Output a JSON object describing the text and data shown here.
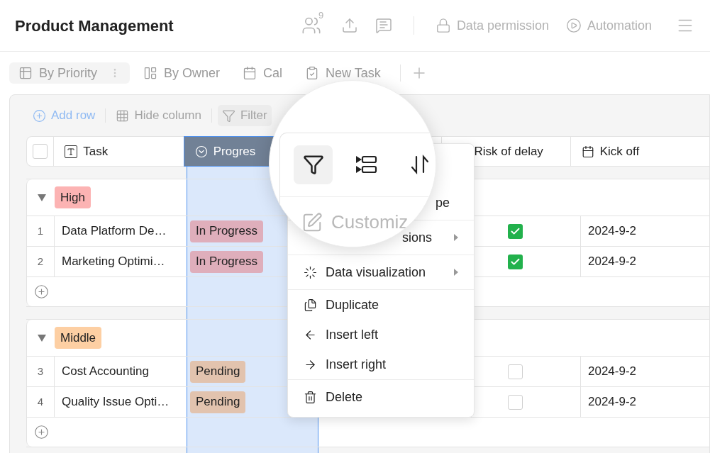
{
  "header": {
    "title": "Product Management",
    "collaborators_count": "9",
    "actions": [
      {
        "kind": "lock",
        "label": "Data permission"
      },
      {
        "kind": "automation",
        "label": "Automation"
      }
    ]
  },
  "views": [
    {
      "kind": "grid",
      "label": "By Priority",
      "selected": true
    },
    {
      "kind": "kanban",
      "label": "By Owner",
      "selected": false
    },
    {
      "kind": "calendar",
      "label": "Cal",
      "selected": false
    },
    {
      "kind": "form",
      "label": "New Task",
      "selected": false
    }
  ],
  "toolbar": [
    {
      "kind": "add",
      "label": "Add row"
    },
    {
      "kind": "hide",
      "label": "Hide column"
    },
    {
      "kind": "filter",
      "label": "Filter"
    }
  ],
  "header_checkbox": {
    "checked": false
  },
  "columns": [
    {
      "kind": "text",
      "label": "Task",
      "selected": false
    },
    {
      "kind": "select",
      "label": "Progres",
      "selected": true
    },
    {
      "kind": "check",
      "label": "Risk of delay",
      "selected": false
    },
    {
      "kind": "date",
      "label": "Kick off",
      "selected": false
    }
  ],
  "groups": [
    {
      "label": "High",
      "color": "#fcb3b3",
      "expanded": true,
      "rows": [
        {
          "index": "1",
          "task": "Data Platform De…",
          "progress": {
            "label": "In Progress",
            "color": "#dfaebb"
          },
          "risk": true,
          "kick_off": "2024-9-2"
        },
        {
          "index": "2",
          "task": "Marketing Optimi…",
          "progress": {
            "label": "In Progress",
            "color": "#dfaebb"
          },
          "risk": true,
          "kick_off": "2024-9-2"
        }
      ]
    },
    {
      "label": "Middle",
      "color": "#fdcfa3",
      "expanded": true,
      "rows": [
        {
          "index": "3",
          "task": "Cost Accounting",
          "progress": {
            "label": "Pending",
            "color": "#e2c3ae"
          },
          "risk": false,
          "kick_off": "2024-9-2"
        },
        {
          "index": "4",
          "task": "Quality Issue Opti…",
          "progress": {
            "label": "Pending",
            "color": "#e2c3ae"
          },
          "risk": false,
          "kick_off": "2024-9-2"
        }
      ]
    }
  ],
  "menu": {
    "sections": [
      [
        {
          "kind": "partial",
          "label": "pe",
          "submenu": false
        }
      ],
      [
        {
          "kind": "partial",
          "label": "sions",
          "submenu": true
        }
      ],
      [
        {
          "kind": "visualize",
          "label": "Data visualization",
          "submenu": true
        }
      ],
      [
        {
          "kind": "duplicate",
          "label": "Duplicate",
          "submenu": false
        },
        {
          "kind": "left",
          "label": "Insert left",
          "submenu": false
        },
        {
          "kind": "right",
          "label": "Insert right",
          "submenu": false
        }
      ],
      [
        {
          "kind": "delete",
          "label": "Delete",
          "submenu": false
        }
      ]
    ]
  },
  "magnifier": {
    "tools": [
      {
        "kind": "filter",
        "selected": true
      },
      {
        "kind": "group",
        "selected": false
      },
      {
        "kind": "sort",
        "selected": false
      }
    ],
    "item": "Customiz"
  }
}
